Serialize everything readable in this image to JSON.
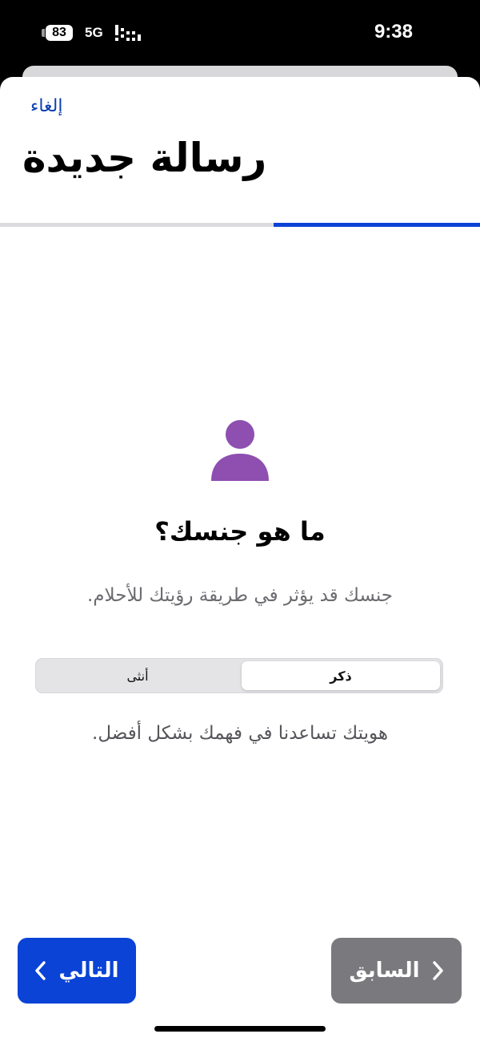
{
  "status_bar": {
    "battery": "83",
    "network": "5G",
    "time": "9:38",
    "icons": [
      "battery-icon",
      "signal-icon"
    ]
  },
  "header": {
    "cancel_label": "إلغاء",
    "title": "رسالة جديدة",
    "progress_percent": 43
  },
  "main": {
    "icon": "person-icon",
    "question": "ما هو جنسك؟",
    "description": "جنسك قد يؤثر في طريقة رؤيتك للأحلام.",
    "gender_options": [
      "ذكر",
      "أنثى"
    ],
    "selected_gender": "ذكر",
    "helper_text": "هويتك تساعدنا في فهمك بشكل أفضل."
  },
  "footer": {
    "next_label": "التالي",
    "prev_label": "السابق",
    "icons": [
      "chevron-left-icon",
      "chevron-right-icon"
    ]
  },
  "colors": {
    "accent": "#0a43d6",
    "icon_purple": "#8e4fb0",
    "prev_button": "#7a7a7e",
    "progress_track": "#dcdcdf"
  }
}
